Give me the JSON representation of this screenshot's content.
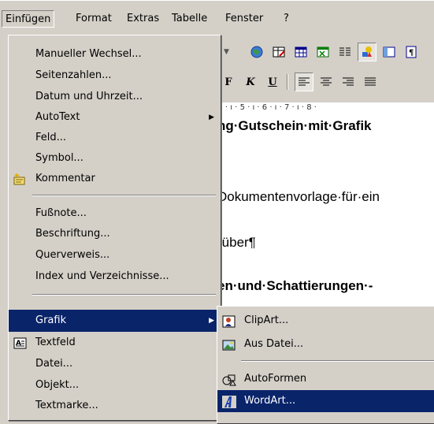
{
  "menubar": {
    "items": [
      {
        "label": "Einfügen",
        "active": true
      },
      {
        "label": "Format"
      },
      {
        "label": "Extras"
      },
      {
        "label": "Tabelle"
      },
      {
        "label": "Fenster"
      },
      {
        "label": "?"
      }
    ]
  },
  "toolbar": {
    "bold": "F",
    "italic": "K",
    "underline": "U"
  },
  "ruler": {
    "text": "· 4 · ı · 5 · ı · 6 · ı · 7 · ı · 8 ·"
  },
  "document": {
    "lines": [
      "ng·Gutschein·mit·Grafik",
      "Dokumentenvorlage·für·ein",
      "·über¶",
      "en·und·Schattierungen·-"
    ]
  },
  "insert_menu": {
    "items": [
      {
        "label": "Manueller Wechsel..."
      },
      {
        "label": "Seitenzahlen..."
      },
      {
        "label": "Datum und Uhrzeit..."
      },
      {
        "label": "AutoText",
        "submenu": true
      },
      {
        "label": "Feld..."
      },
      {
        "label": "Symbol..."
      },
      {
        "label": "Kommentar",
        "icon": "comment-icon"
      },
      {
        "label": "Fußnote..."
      },
      {
        "label": "Beschriftung..."
      },
      {
        "label": "Querverweis..."
      },
      {
        "label": "Index und Verzeichnisse..."
      },
      {
        "label": "Grafik",
        "submenu": true,
        "highlighted": true
      },
      {
        "label": "Textfeld",
        "icon": "textbox-icon"
      },
      {
        "label": "Datei..."
      },
      {
        "label": "Objekt..."
      },
      {
        "label": "Textmarke..."
      }
    ]
  },
  "grafik_submenu": {
    "items": [
      {
        "label": "ClipArt...",
        "icon": "clipart-icon"
      },
      {
        "label": "Aus Datei...",
        "icon": "picture-from-file-icon"
      },
      {
        "label": "AutoFormen",
        "icon": "autoshapes-icon"
      },
      {
        "label": "WordArt...",
        "icon": "wordart-icon",
        "highlighted": true
      }
    ]
  },
  "colors": {
    "menu_bg": "#d4d0c8",
    "highlight": "#0a246a",
    "document_bg": "#ffffff"
  }
}
